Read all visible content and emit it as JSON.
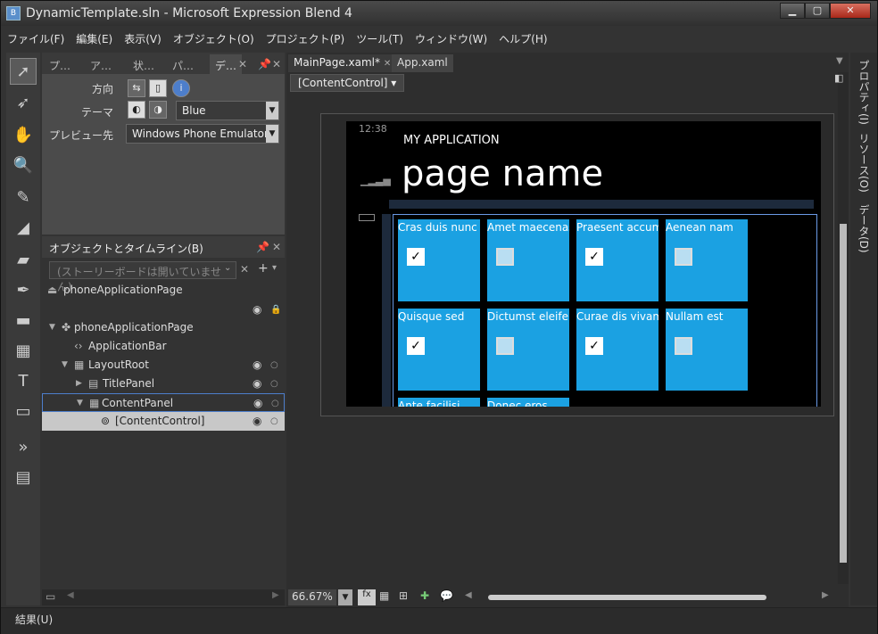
{
  "title": "DynamicTemplate.sln - Microsoft Expression Blend 4",
  "menu": [
    "ファイル(F)",
    "編集(E)",
    "表示(V)",
    "オブジェクト(O)",
    "プロジェクト(P)",
    "ツール(T)",
    "ウィンドウ(W)",
    "ヘルプ(H)"
  ],
  "tabs": [
    "プ…",
    "ア…",
    "状…",
    "パ…",
    "デ…"
  ],
  "props": {
    "direction_label": "方向",
    "theme_label": "テーマ",
    "theme_value": "Blue",
    "preview_label": "プレビュー先",
    "preview_value": "Windows Phone Emulator(J"
  },
  "objects": {
    "header": "オブジェクトとタイムライン(B)",
    "search_placeholder": "(ストーリーボードは開いていません)",
    "tree": [
      "phoneApplicationPage",
      "phoneApplicationPage",
      "ApplicationBar",
      "LayoutRoot",
      "TitlePanel",
      "ContentPanel",
      "[ContentControl]"
    ]
  },
  "doc": {
    "tabs": [
      "MainPage.xaml*",
      "App.xaml"
    ],
    "breadcrumb": "[ContentControl]",
    "zoom": "66.67%"
  },
  "phone": {
    "clock": "12:38",
    "app_name": "MY APPLICATION",
    "page_name": "page name",
    "tiles": [
      {
        "label": "Cras duis nunc",
        "checked": true
      },
      {
        "label": "Amet maecenas",
        "checked": false
      },
      {
        "label": "Praesent accums",
        "checked": true
      },
      {
        "label": "Aenean nam",
        "checked": false
      },
      {
        "label": "Quisque sed",
        "checked": true
      },
      {
        "label": "Dictumst eleifen",
        "checked": false
      },
      {
        "label": "Curae dis vivamu",
        "checked": true
      },
      {
        "label": "Nullam est",
        "checked": false
      },
      {
        "label": "Ante facilisi",
        "checked": false
      },
      {
        "label": "Donec eros",
        "checked": false
      }
    ]
  },
  "right_tabs": [
    "プロパティ(I)",
    "リソース(O)",
    "データ(D)"
  ],
  "status": "結果(U)"
}
